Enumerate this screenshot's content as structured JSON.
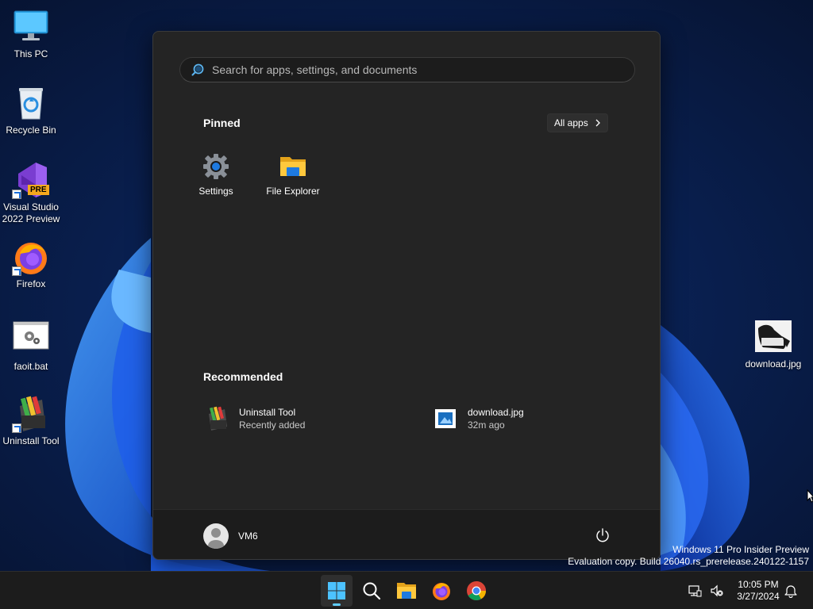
{
  "desktop": {
    "icons": [
      {
        "label": "This PC",
        "icon": "monitor-icon"
      },
      {
        "label": "Recycle Bin",
        "icon": "recycle-bin-icon"
      },
      {
        "label": "Visual Studio\n2022 Preview",
        "icon": "visual-studio-icon",
        "badge": "PRE"
      },
      {
        "label": "Firefox",
        "icon": "firefox-icon"
      },
      {
        "label": "faoit.bat",
        "icon": "batch-file-icon"
      },
      {
        "label": "Uninstall Tool",
        "icon": "uninstall-tool-icon"
      },
      {
        "label": "download.jpg",
        "icon": "image-thumbnail-icon"
      }
    ]
  },
  "start_menu": {
    "search_placeholder": "Search for apps, settings, and documents",
    "pinned_title": "Pinned",
    "all_apps_label": "All apps",
    "pinned": [
      {
        "label": "Settings",
        "icon": "settings-gear-icon"
      },
      {
        "label": "File Explorer",
        "icon": "folder-icon"
      }
    ],
    "recommended_title": "Recommended",
    "recommended": [
      {
        "name": "Uninstall Tool",
        "detail": "Recently added",
        "icon": "uninstall-tool-icon"
      },
      {
        "name": "download.jpg",
        "detail": "32m ago",
        "icon": "image-file-icon"
      }
    ],
    "user_name": "VM6"
  },
  "watermark": {
    "line1": "Windows 11 Pro Insider Preview",
    "line2": "Evaluation copy. Build 26040.rs_prerelease.240122-1157"
  },
  "taskbar": {
    "apps": [
      "start-icon",
      "search-icon",
      "file-explorer-icon",
      "firefox-icon",
      "chrome-icon"
    ],
    "time": "10:05 PM",
    "date": "3/27/2024"
  },
  "colors": {
    "accent": "#60cdff",
    "menu_bg": "#242424",
    "taskbar_bg": "#1c1c1c"
  }
}
